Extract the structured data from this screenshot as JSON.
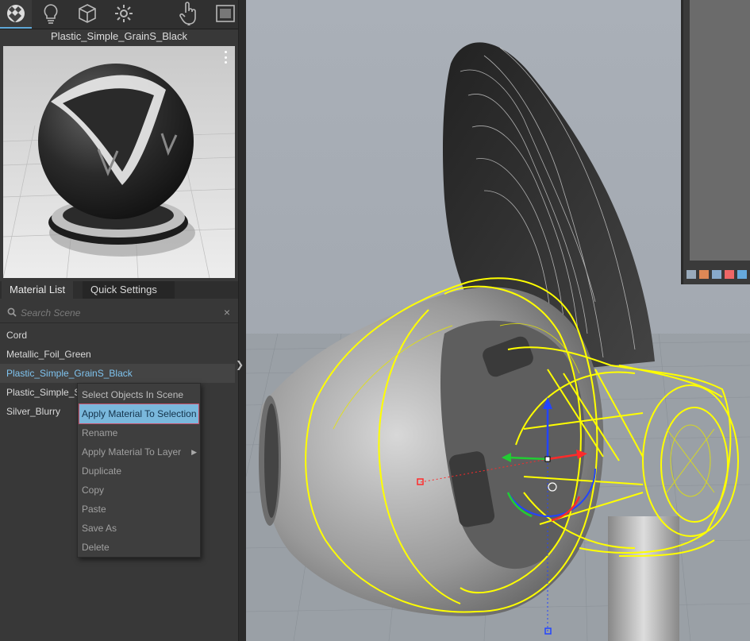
{
  "toolbar": {
    "tools": [
      {
        "icon": "material-ball-icon",
        "active": true
      },
      {
        "icon": "light-bulb-icon",
        "active": false
      },
      {
        "icon": "cube-icon",
        "active": false
      },
      {
        "icon": "gear-icon",
        "active": false
      },
      {
        "icon": "hand-pointer-icon",
        "active": false
      },
      {
        "icon": "render-frame-icon",
        "active": false
      }
    ]
  },
  "material": {
    "title": "Plastic_Simple_GrainS_Black"
  },
  "tabs": {
    "material_list": "Material List",
    "quick_settings": "Quick Settings"
  },
  "search": {
    "placeholder": "Search Scene",
    "clear": "×"
  },
  "materials": [
    "Cord",
    "Metallic_Foil_Green",
    "Plastic_Simple_GrainS_Black",
    "Plastic_Simple_Sh",
    "Silver_Blurry"
  ],
  "context_menu": {
    "select_objects": "Select Objects In Scene",
    "apply_selection": "Apply Material To Selection",
    "rename": "Rename",
    "apply_layer": "Apply Material To Layer",
    "duplicate": "Duplicate",
    "copy": "Copy",
    "paste": "Paste",
    "save_as": "Save As",
    "delete": "Delete"
  },
  "colors": {
    "selection_text": "#7fc4f0",
    "menu_highlight": "#7ab8dc",
    "wireframe_selection": "#ffff00",
    "viewport_background": "#a7adb5"
  }
}
